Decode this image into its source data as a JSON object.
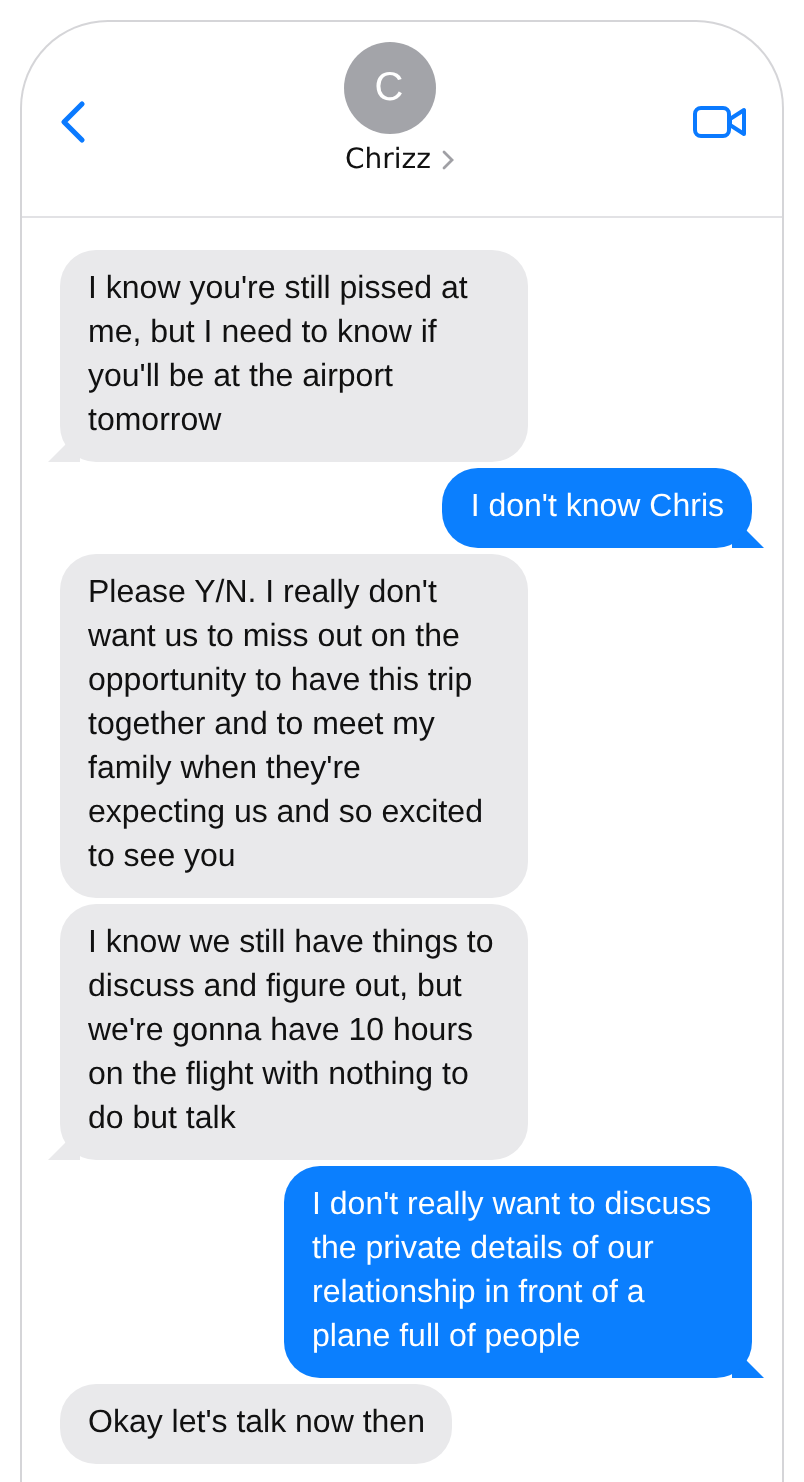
{
  "header": {
    "avatar_initial": "C",
    "contact_name": "Chrizz"
  },
  "messages": [
    {
      "kind": "incoming",
      "text": "I know you're still pissed at me, but I need to know if you'll be at the airport tomorrow",
      "tail": true
    },
    {
      "kind": "outgoing",
      "text": "I don't know Chris",
      "tail": true
    },
    {
      "kind": "incoming",
      "text": "Please Y/N. I really don't want us to miss out on the opportunity to have this trip together and to meet my family when they're expecting us and so excited to see you",
      "tail": false
    },
    {
      "kind": "incoming",
      "text": "I know we still have things to discuss and figure out, but we're gonna have 10 hours on the flight with nothing to do but talk",
      "tail": true
    },
    {
      "kind": "outgoing",
      "text": "I don't really want to discuss the private details of our relationship in front of a plane full of people",
      "tail": true
    },
    {
      "kind": "incoming",
      "text": "Okay let's talk now then",
      "tail": false
    }
  ]
}
